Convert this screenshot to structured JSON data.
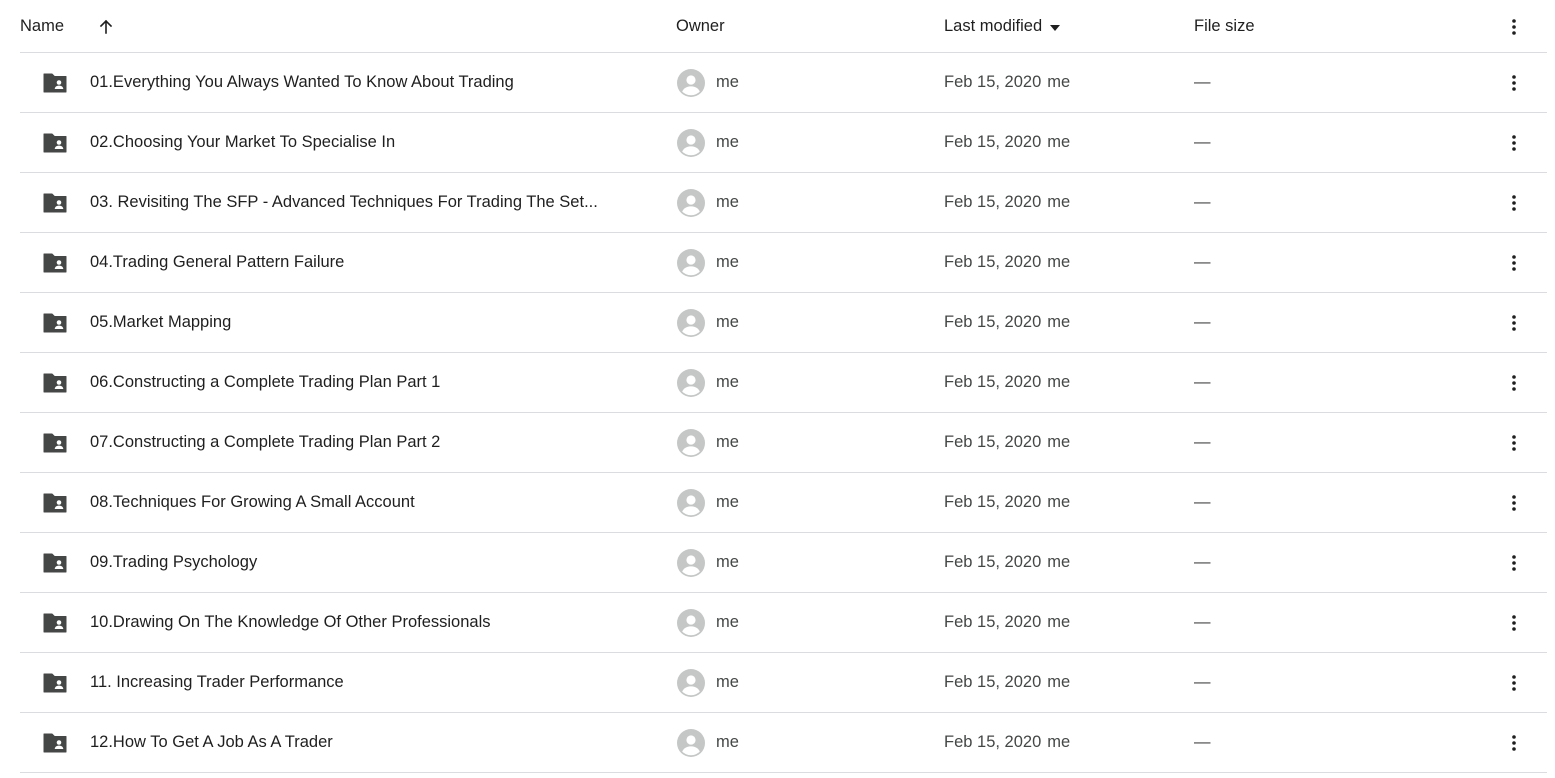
{
  "header": {
    "name_label": "Name",
    "sort_icon": "arrow-up-icon",
    "owner_label": "Owner",
    "modified_label": "Last modified",
    "modified_icon": "caret-down-icon",
    "size_label": "File size",
    "more_icon": "more-vert-icon"
  },
  "colors": {
    "text": "#1f1f1f",
    "secondary_text": "#444746",
    "divider": "#dadce0",
    "folder_icon": "#444746",
    "avatar": "#c4c7c5"
  },
  "rows": [
    {
      "name": "01.Everything You Always Wanted To Know About Trading",
      "owner": "me",
      "date": "Feb 15, 2020",
      "modified_by": "me",
      "size": "—"
    },
    {
      "name": "02.Choosing Your Market To Specialise In",
      "owner": "me",
      "date": "Feb 15, 2020",
      "modified_by": "me",
      "size": "—"
    },
    {
      "name": "03. Revisiting The SFP - Advanced Techniques For Trading The Set...",
      "owner": "me",
      "date": "Feb 15, 2020",
      "modified_by": "me",
      "size": "—"
    },
    {
      "name": "04.Trading General Pattern Failure",
      "owner": "me",
      "date": "Feb 15, 2020",
      "modified_by": "me",
      "size": "—"
    },
    {
      "name": "05.Market Mapping",
      "owner": "me",
      "date": "Feb 15, 2020",
      "modified_by": "me",
      "size": "—"
    },
    {
      "name": "06.Constructing a Complete Trading Plan Part 1",
      "owner": "me",
      "date": "Feb 15, 2020",
      "modified_by": "me",
      "size": "—"
    },
    {
      "name": "07.Constructing a Complete Trading Plan Part 2",
      "owner": "me",
      "date": "Feb 15, 2020",
      "modified_by": "me",
      "size": "—"
    },
    {
      "name": "08.Techniques For Growing A Small Account",
      "owner": "me",
      "date": "Feb 15, 2020",
      "modified_by": "me",
      "size": "—"
    },
    {
      "name": "09.Trading Psychology",
      "owner": "me",
      "date": "Feb 15, 2020",
      "modified_by": "me",
      "size": "—"
    },
    {
      "name": "10.Drawing On The Knowledge Of Other Professionals",
      "owner": "me",
      "date": "Feb 15, 2020",
      "modified_by": "me",
      "size": "—"
    },
    {
      "name": "11. Increasing Trader Performance",
      "owner": "me",
      "date": "Feb 15, 2020",
      "modified_by": "me",
      "size": "—"
    },
    {
      "name": "12.How To Get A Job As A Trader",
      "owner": "me",
      "date": "Feb 15, 2020",
      "modified_by": "me",
      "size": "—"
    }
  ]
}
